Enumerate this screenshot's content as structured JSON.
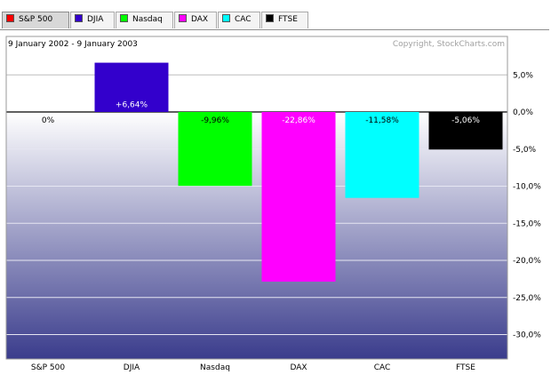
{
  "tabs": [
    {
      "label": "S&P 500",
      "color": "#ff0000",
      "active": true
    },
    {
      "label": "DJIA",
      "color": "#3300cc",
      "active": false
    },
    {
      "label": "Nasdaq",
      "color": "#00ff00",
      "active": false
    },
    {
      "label": "DAX",
      "color": "#ff00ff",
      "active": false
    },
    {
      "label": "CAC",
      "color": "#00ffff",
      "active": false
    },
    {
      "label": "FTSE",
      "color": "#000000",
      "active": false
    }
  ],
  "chart_data": {
    "type": "bar",
    "subtitle": "9 January 2002 - 9 January 2003",
    "copyright": "Copyright, StockCharts.com",
    "categories": [
      "S&P 500",
      "DJIA",
      "Nasdaq",
      "DAX",
      "CAC",
      "FTSE"
    ],
    "values": [
      0,
      6.64,
      -9.96,
      -22.86,
      -11.58,
      -5.06
    ],
    "value_labels": [
      "0%",
      "+6,64%",
      "-9,96%",
      "-22,86%",
      "-11,58%",
      "-5,06%"
    ],
    "colors": [
      "#ff0000",
      "#3300cc",
      "#00ff00",
      "#ff00ff",
      "#00ffff",
      "#000000"
    ],
    "y_ticks": [
      5,
      0,
      -5,
      -10,
      -15,
      -20,
      -25,
      -30
    ],
    "y_tick_labels": [
      "5,0%",
      "0,0%",
      "-5,0%",
      "-10,0%",
      "-15,0%",
      "-20,0%",
      "-25,0%",
      "-30,0%"
    ],
    "ylim": [
      -32.5,
      10
    ],
    "y_axis_side": "right",
    "grid": true
  }
}
